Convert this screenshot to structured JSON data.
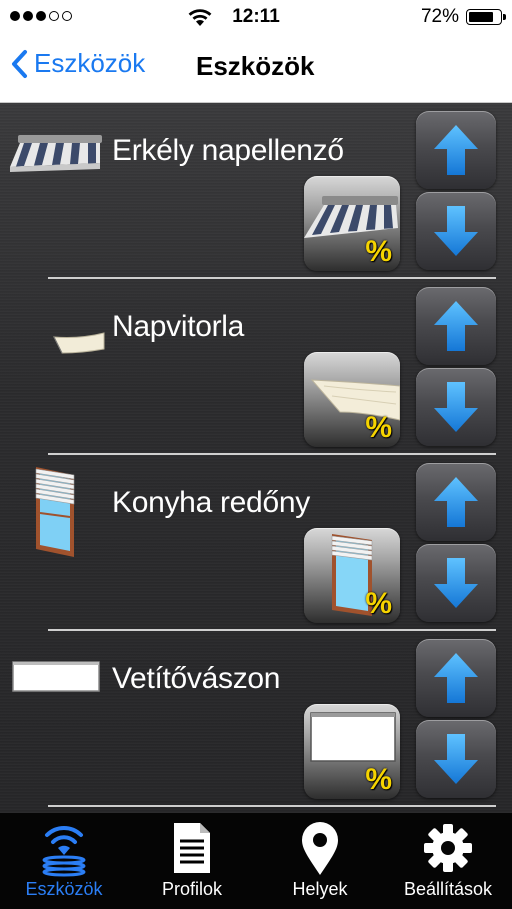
{
  "status_bar": {
    "time": "12:11",
    "battery_percent": "72%",
    "battery_level": 0.72,
    "signal_bars_filled": 3,
    "signal_bars_total": 5
  },
  "nav": {
    "back_label": "Eszközök",
    "title": "Eszközök"
  },
  "devices": [
    {
      "name": "Erkély napellenző",
      "icon": "awning-icon",
      "percent_label": "%"
    },
    {
      "name": "Napvitorla",
      "icon": "sail-shade-icon",
      "percent_label": "%"
    },
    {
      "name": "Konyha redőny",
      "icon": "window-shutter-icon",
      "percent_label": "%"
    },
    {
      "name": "Vetítővászon",
      "icon": "projector-screen-icon",
      "percent_label": "%"
    }
  ],
  "tabs": [
    {
      "label": "Eszközök",
      "icon": "wireless-devices-icon",
      "active": true
    },
    {
      "label": "Profilok",
      "icon": "document-icon",
      "active": false
    },
    {
      "label": "Helyek",
      "icon": "location-pin-icon",
      "active": false
    },
    {
      "label": "Beállítások",
      "icon": "gear-icon",
      "active": false
    }
  ],
  "colors": {
    "accent": "#1a79f0",
    "active_tab": "#2b7ef5",
    "arrow_blue": "#1e8fe8",
    "percent_yellow": "#f6d400",
    "content_bg": "#2e2e30"
  }
}
